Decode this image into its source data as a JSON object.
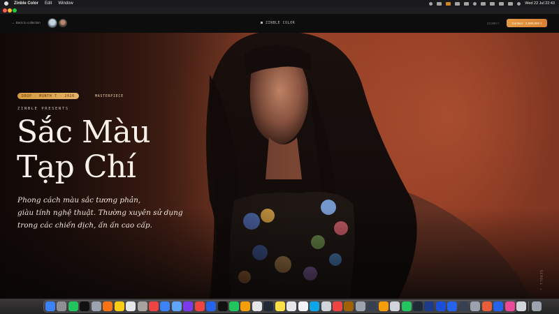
{
  "menubar": {
    "app_name": "Zinble Color",
    "menus": [
      "Edit",
      "Window"
    ],
    "clock": "Wed 22 Jul  22:43"
  },
  "nav": {
    "back": "← Back to collection",
    "brand": "ZINBLE COLOR",
    "price": "22,990 ₫",
    "cta": "Contact · 2,990,000 ₫"
  },
  "hero": {
    "tag": "DROP · MONTH 7 · 2026",
    "tag_after": "MASTERPIECE",
    "presents": "ZINBLE PRESENTS",
    "title_line1": "Sắc Màu",
    "title_line2": "Tạp Chí",
    "subtitle_line1": "Phong cách màu sắc tương phản,",
    "subtitle_line2": "giàu tính nghệ thuật. Thường xuyên sử dụng",
    "subtitle_line3": "trong các chiến dịch, ấn ấn cao cấp.",
    "scroll": "SCROLL ↓"
  },
  "colors": {
    "accent": "#e29a43",
    "hero_bg": "#8e4128",
    "tag_bg": "#d69a3d"
  },
  "dock": {
    "apps": [
      {
        "name": "finder",
        "color": "#3b82f6"
      },
      {
        "name": "system-settings",
        "color": "#8e8e93"
      },
      {
        "name": "wechat",
        "color": "#22c55e"
      },
      {
        "name": "terminal",
        "color": "#111111"
      },
      {
        "name": "launchpad",
        "color": "#9ca3af"
      },
      {
        "name": "photos",
        "color": "#f97316"
      },
      {
        "name": "notes",
        "color": "#facc15"
      },
      {
        "name": "calendar",
        "color": "#e5e7eb"
      },
      {
        "name": "contacts",
        "color": "#a8a29e"
      },
      {
        "name": "chrome",
        "color": "#ef4444"
      },
      {
        "name": "app-store",
        "color": "#3b82f6"
      },
      {
        "name": "finder-2",
        "color": "#60a5fa"
      },
      {
        "name": "slack",
        "color": "#7c3aed"
      },
      {
        "name": "mail",
        "color": "#ef4444"
      },
      {
        "name": "docs",
        "color": "#2563eb"
      },
      {
        "name": "tiktok",
        "color": "#111111"
      },
      {
        "name": "camo",
        "color": "#22c55e"
      },
      {
        "name": "chrome-2",
        "color": "#f59e0b"
      },
      {
        "name": "chatgpt",
        "color": "#e5e7eb"
      },
      {
        "name": "capcut",
        "color": "#1f2937"
      },
      {
        "name": "sd",
        "color": "#fde047"
      },
      {
        "name": "figma",
        "color": "#e5e7eb"
      },
      {
        "name": "files",
        "color": "#f3f4f6"
      },
      {
        "name": "edge",
        "color": "#0ea5e9"
      },
      {
        "name": "preview",
        "color": "#d1d5db"
      },
      {
        "name": "youtube",
        "color": "#ef4444"
      },
      {
        "name": "paintbrush",
        "color": "#a16207"
      },
      {
        "name": "calculator",
        "color": "#9ca3af"
      },
      {
        "name": "screen-share",
        "color": "#374151"
      },
      {
        "name": "keynote",
        "color": "#f59e0b"
      },
      {
        "name": "archive",
        "color": "#d1d5db"
      },
      {
        "name": "camera",
        "color": "#22c55e"
      },
      {
        "name": "z",
        "color": "#1f2937"
      },
      {
        "name": "photoshop",
        "color": "#1e3a8a"
      },
      {
        "name": "boot",
        "color": "#1d4ed8"
      },
      {
        "name": "vscode",
        "color": "#2563eb"
      },
      {
        "name": "dashboard",
        "color": "#374151"
      },
      {
        "name": "safari",
        "color": "#9ca3af"
      },
      {
        "name": "folder-1",
        "color": "#e85d3a"
      },
      {
        "name": "folder-2",
        "color": "#2563eb"
      },
      {
        "name": "folder-3",
        "color": "#ec4899"
      },
      {
        "name": "display",
        "color": "#d1d5db"
      },
      {
        "name": "trash",
        "color": "#9ca3af"
      }
    ]
  }
}
